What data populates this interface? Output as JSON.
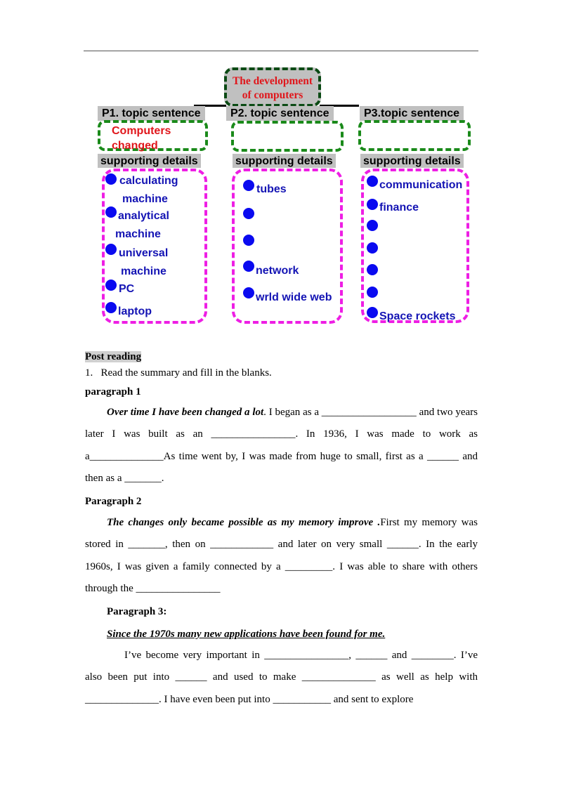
{
  "diagram": {
    "title": "The development of computers",
    "title_line1": "The development",
    "title_line2": "of computers",
    "columns": [
      {
        "topic_label": "P1. topic sentence",
        "topic_text_line1": "Computers",
        "topic_text_line2": "changed",
        "details_label": "supporting details",
        "items": [
          "calculating",
          "analytical",
          "universal",
          "PC",
          "laptop"
        ],
        "continuations": [
          "machine",
          "machine",
          "machine"
        ]
      },
      {
        "topic_label": "P2. topic sentence",
        "topic_text_line1": "",
        "topic_text_line2": "",
        "details_label": "supporting details",
        "items": [
          "tubes",
          "",
          "",
          "network",
          "wrld wide web"
        ]
      },
      {
        "topic_label": "P3.topic sentence",
        "topic_text_line1": "",
        "topic_text_line2": "",
        "details_label": "supporting details",
        "items": [
          "communication",
          "finance",
          "",
          "",
          "",
          "",
          "Space rockets"
        ]
      }
    ],
    "colors": {
      "title_text": "#e0161b",
      "title_border": "#0b4a14",
      "topic_border": "#1a8a1a",
      "details_border": "#ee1ee4",
      "bullet": "#0a0af0",
      "item_text": "#1414b4",
      "label_bg": "#c0c0c0"
    }
  },
  "post_reading": {
    "heading": "Post reading",
    "instruction": "1.   Read the summary and fill in the blanks.",
    "p1_heading": "paragraph 1",
    "p1_lead": "Over time I have been changed a lot",
    "p1_text": ". I began as a __________________ and two years later I was built as an ________________. In 1936, I was made to work as a______________As time went by, I was made from huge to small, first as a ______ and then as a _______.",
    "p2_heading": "Paragraph 2",
    "p2_lead": "The changes only became possible as my memory improve .",
    "p2_text": "First my memory was stored in _______, then on ____________ and later on very small ______. In the early 1960s, I was given a family connected by a _________. I was able to share with others through the ________________",
    "p3_heading": "Paragraph 3:",
    "p3_lead": "Since the 1970s many new applications have been found for me.",
    "p3_text": "I’ve become very important in ________________, ______ and ________. I’ve also been put into ______ and used to make ______________ as well as help with ______________. I    have even been put into ___________ and sent to explore"
  }
}
